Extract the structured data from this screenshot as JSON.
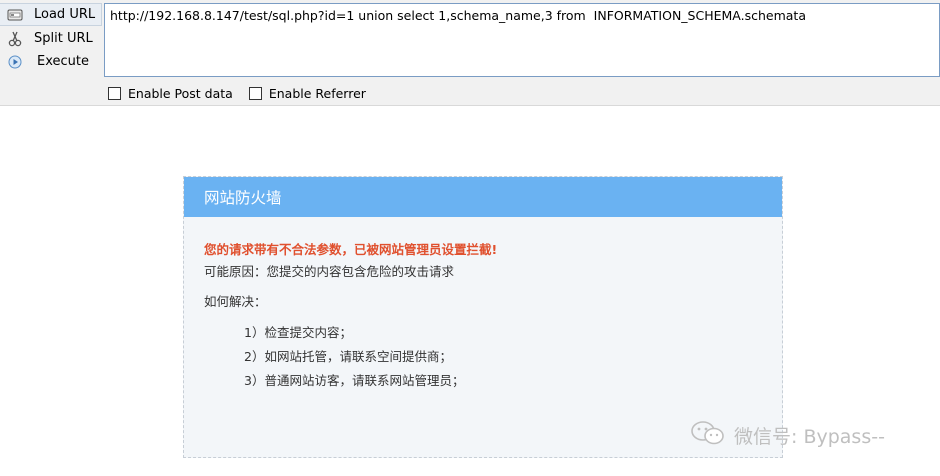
{
  "toolbar": {
    "load_label": "Load URL",
    "split_label": "Split URL",
    "execute_label": "Execute",
    "url_value": "http://192.168.8.147/test/sql.php?id=1 union select 1,schema_name,3 from  INFORMATION_SCHEMA.schemata",
    "enable_post_label": "Enable Post data",
    "enable_referrer_label": "Enable Referrer"
  },
  "firewall": {
    "title": "网站防火墙",
    "warning": "您的请求带有不合法参数，已被网站管理员设置拦截!",
    "reason": "可能原因：您提交的内容包含危险的攻击请求",
    "howto": "如何解决：",
    "steps": [
      "1）检查提交内容；",
      "2）如网站托管，请联系空间提供商；",
      "3）普通网站访客，请联系网站管理员；"
    ]
  },
  "watermark": {
    "text": "微信号: Bypass--"
  },
  "colors": {
    "header_blue": "#6ab2f2",
    "warning_red": "#e0502e",
    "card_bg": "#f3f6f9"
  },
  "icons": {
    "load": "load-url-icon",
    "split": "split-url-icon",
    "execute": "execute-icon",
    "watermark": "wechat-icon"
  }
}
